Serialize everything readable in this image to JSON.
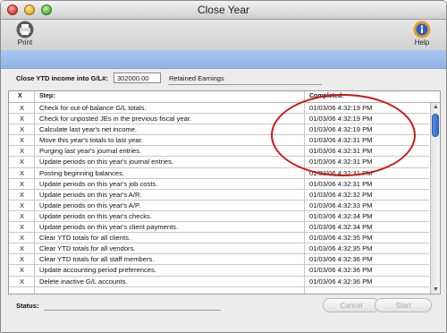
{
  "window": {
    "title": "Close Year"
  },
  "toolbar": {
    "print_label": "Print",
    "help_label": "Help"
  },
  "settings": {
    "gl_label": "Close YTD income into G/L#:",
    "gl_account": "302000.00",
    "gl_account_name": "Retained Earnings"
  },
  "table": {
    "headers": {
      "x": "X",
      "step": "Step:",
      "completed": "Completed:"
    },
    "rows": [
      {
        "x": "X",
        "step": "Check for out-of-balance G/L totals.",
        "completed": "01/03/06 4:32:19 PM"
      },
      {
        "x": "X",
        "step": "Check for unposted JEs in the previous fiscal year.",
        "completed": "01/03/06 4:32:19 PM"
      },
      {
        "x": "X",
        "step": "Calculate last year's net income.",
        "completed": "01/03/06 4:32:19 PM"
      },
      {
        "x": "X",
        "step": "Move this year's totals to last year.",
        "completed": "01/03/06 4:32:31 PM"
      },
      {
        "x": "X",
        "step": "Purging last year's journal entries.",
        "completed": "01/03/06 4:32:31 PM"
      },
      {
        "x": "X",
        "step": "Update periods on this year's journal entries.",
        "completed": "01/03/06 4:32:31 PM"
      },
      {
        "x": "X",
        "step": "Posting beginning balances.",
        "completed": "01/03/06 4:32:31 PM"
      },
      {
        "x": "X",
        "step": "Update periods on this year's job costs.",
        "completed": "01/03/06 4:32:31 PM"
      },
      {
        "x": "X",
        "step": "Update periods on this year's A/R.",
        "completed": "01/03/06 4:32:32 PM"
      },
      {
        "x": "X",
        "step": "Update periods on this year's A/P.",
        "completed": "01/03/06 4:32:33 PM"
      },
      {
        "x": "X",
        "step": "Update periods on this year's checks.",
        "completed": "01/03/06 4:32:34 PM"
      },
      {
        "x": "X",
        "step": "Update periods on this year's client payments.",
        "completed": "01/03/06 4:32:34 PM"
      },
      {
        "x": "X",
        "step": "Clear YTD totals for all clients.",
        "completed": "01/03/06 4:32:35 PM"
      },
      {
        "x": "X",
        "step": "Clear YTD totals for all vendors.",
        "completed": "01/03/06 4:32:35 PM"
      },
      {
        "x": "X",
        "step": "Clear YTD totals for all staff members.",
        "completed": "01/03/06 4:32:36 PM"
      },
      {
        "x": "X",
        "step": "Update accounting period preferences.",
        "completed": "01/03/06 4:32:36 PM"
      },
      {
        "x": "X",
        "step": "Delete inactive G/L accounts.",
        "completed": "01/03/06 4:32:36 PM"
      }
    ]
  },
  "status": {
    "label": "Status:"
  },
  "buttons": {
    "cancel": "Cancel",
    "start": "Start"
  },
  "colors": {
    "highlight_circle": "#cc1818",
    "band": "#9dbde9",
    "scroll_thumb": "#2e6cd0"
  }
}
